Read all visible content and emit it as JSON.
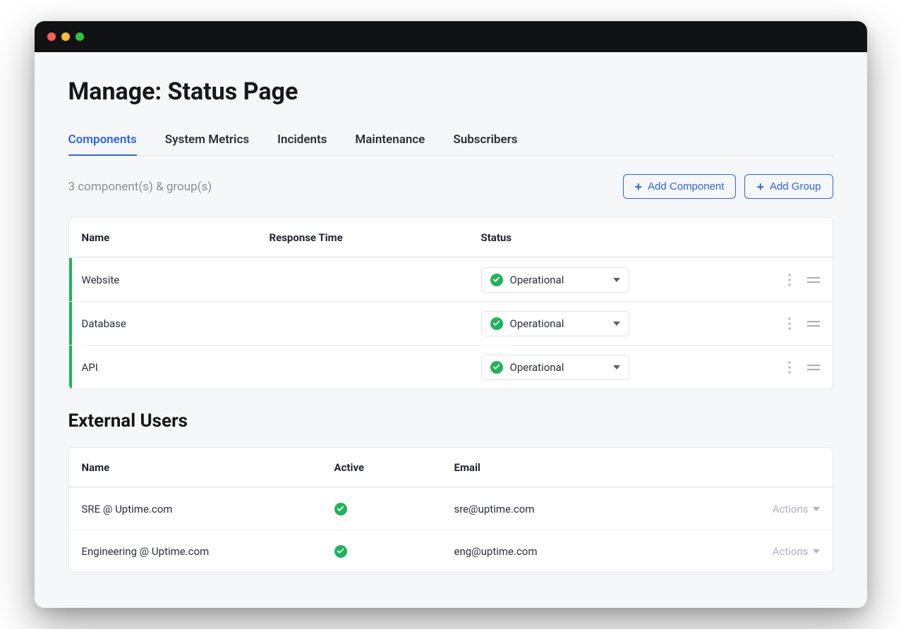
{
  "colors": {
    "accent": "#2b66e6",
    "success": "#1fb45a"
  },
  "page": {
    "title": "Manage: Status Page"
  },
  "tabs": [
    {
      "label": "Components",
      "active": true
    },
    {
      "label": "System Metrics",
      "active": false
    },
    {
      "label": "Incidents",
      "active": false
    },
    {
      "label": "Maintenance",
      "active": false
    },
    {
      "label": "Subscribers",
      "active": false
    }
  ],
  "components": {
    "count_text": "3 component(s) & group(s)",
    "buttons": {
      "add_component": "Add Component",
      "add_group": "Add Group"
    },
    "headers": {
      "name": "Name",
      "response_time": "Response Time",
      "status": "Status"
    },
    "rows": [
      {
        "name": "Website",
        "response_time": "",
        "status": "Operational"
      },
      {
        "name": "Database",
        "response_time": "",
        "status": "Operational"
      },
      {
        "name": "API",
        "response_time": "",
        "status": "Operational"
      }
    ]
  },
  "external_users": {
    "title": "External Users",
    "headers": {
      "name": "Name",
      "active": "Active",
      "email": "Email"
    },
    "actions_label": "Actions",
    "rows": [
      {
        "name": "SRE @ Uptime.com",
        "active": true,
        "email": "sre@uptime.com"
      },
      {
        "name": "Engineering @ Uptime.com",
        "active": true,
        "email": "eng@uptime.com"
      }
    ]
  }
}
